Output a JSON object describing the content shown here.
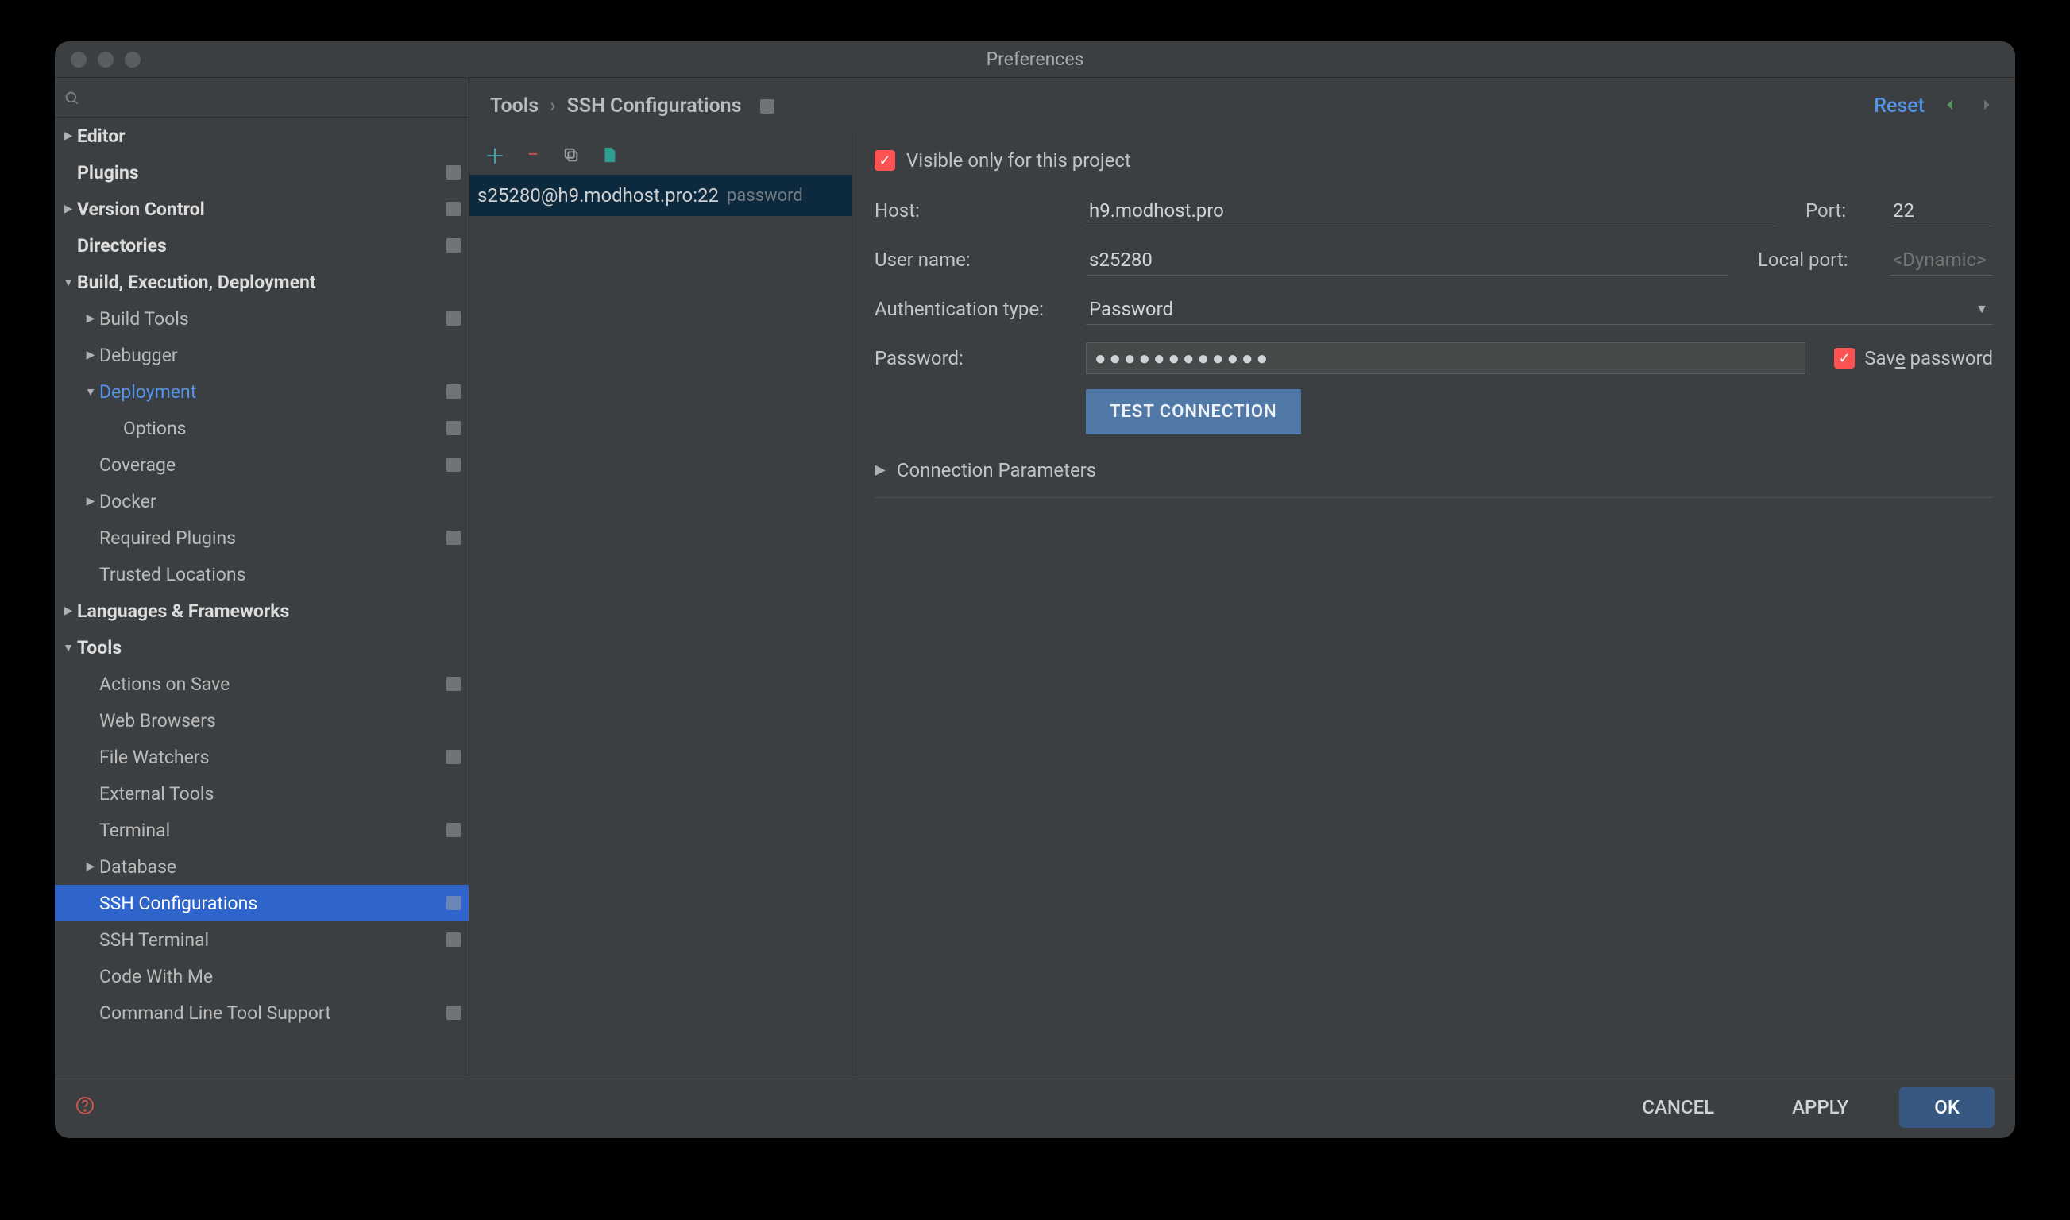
{
  "window": {
    "title": "Preferences"
  },
  "sidebar": {
    "items": [
      {
        "label": "Editor",
        "bold": true,
        "chevron": "right",
        "indent": 0,
        "proj": false
      },
      {
        "label": "Plugins",
        "bold": true,
        "chevron": "",
        "indent": 0,
        "proj": true
      },
      {
        "label": "Version Control",
        "bold": true,
        "chevron": "right",
        "indent": 0,
        "proj": true
      },
      {
        "label": "Directories",
        "bold": true,
        "chevron": "",
        "indent": 0,
        "proj": true
      },
      {
        "label": "Build, Execution, Deployment",
        "bold": true,
        "chevron": "down",
        "indent": 0,
        "proj": false
      },
      {
        "label": "Build Tools",
        "bold": false,
        "chevron": "right",
        "indent": 1,
        "proj": true
      },
      {
        "label": "Debugger",
        "bold": false,
        "chevron": "right",
        "indent": 1,
        "proj": false
      },
      {
        "label": "Deployment",
        "bold": false,
        "chevron": "down",
        "indent": 1,
        "proj": true,
        "link": true
      },
      {
        "label": "Options",
        "bold": false,
        "chevron": "",
        "indent": 2,
        "proj": true
      },
      {
        "label": "Coverage",
        "bold": false,
        "chevron": "",
        "indent": 1,
        "proj": true
      },
      {
        "label": "Docker",
        "bold": false,
        "chevron": "right",
        "indent": 1,
        "proj": false
      },
      {
        "label": "Required Plugins",
        "bold": false,
        "chevron": "",
        "indent": 1,
        "proj": true
      },
      {
        "label": "Trusted Locations",
        "bold": false,
        "chevron": "",
        "indent": 1,
        "proj": false
      },
      {
        "label": "Languages & Frameworks",
        "bold": true,
        "chevron": "right",
        "indent": 0,
        "proj": false
      },
      {
        "label": "Tools",
        "bold": true,
        "chevron": "down",
        "indent": 0,
        "proj": false
      },
      {
        "label": "Actions on Save",
        "bold": false,
        "chevron": "",
        "indent": 1,
        "proj": true
      },
      {
        "label": "Web Browsers",
        "bold": false,
        "chevron": "",
        "indent": 1,
        "proj": false
      },
      {
        "label": "File Watchers",
        "bold": false,
        "chevron": "",
        "indent": 1,
        "proj": true
      },
      {
        "label": "External Tools",
        "bold": false,
        "chevron": "",
        "indent": 1,
        "proj": false
      },
      {
        "label": "Terminal",
        "bold": false,
        "chevron": "",
        "indent": 1,
        "proj": true
      },
      {
        "label": "Database",
        "bold": false,
        "chevron": "right",
        "indent": 1,
        "proj": false
      },
      {
        "label": "SSH Configurations",
        "bold": false,
        "chevron": "",
        "indent": 1,
        "proj": true,
        "selected": true
      },
      {
        "label": "SSH Terminal",
        "bold": false,
        "chevron": "",
        "indent": 1,
        "proj": true
      },
      {
        "label": "Code With Me",
        "bold": false,
        "chevron": "",
        "indent": 1,
        "proj": false
      },
      {
        "label": "Command Line Tool Support",
        "bold": false,
        "chevron": "",
        "indent": 1,
        "proj": true
      }
    ]
  },
  "breadcrumb": {
    "root": "Tools",
    "leaf": "SSH Configurations"
  },
  "reset_label": "Reset",
  "list": {
    "items": [
      {
        "title": "s25280@h9.modhost.pro:22",
        "tag": "password"
      }
    ]
  },
  "form": {
    "visible_label": "Visible only for this project",
    "host_label": "Host:",
    "host_value": "h9.modhost.pro",
    "port_label": "Port:",
    "port_value": "22",
    "user_label": "User name:",
    "user_value": "s25280",
    "lport_label": "Local port:",
    "lport_placeholder": "<Dynamic>",
    "auth_label": "Authentication type:",
    "auth_value": "Password",
    "pw_label": "Password:",
    "pw_value": "●●●●●●●●●●●●",
    "savepw_pre": "Sav",
    "savepw_u": "e",
    "savepw_post": " password",
    "test_label": "TEST CONNECTION",
    "params_label": "Connection Parameters"
  },
  "footer": {
    "cancel": "CANCEL",
    "apply": "APPLY",
    "ok": "OK"
  }
}
